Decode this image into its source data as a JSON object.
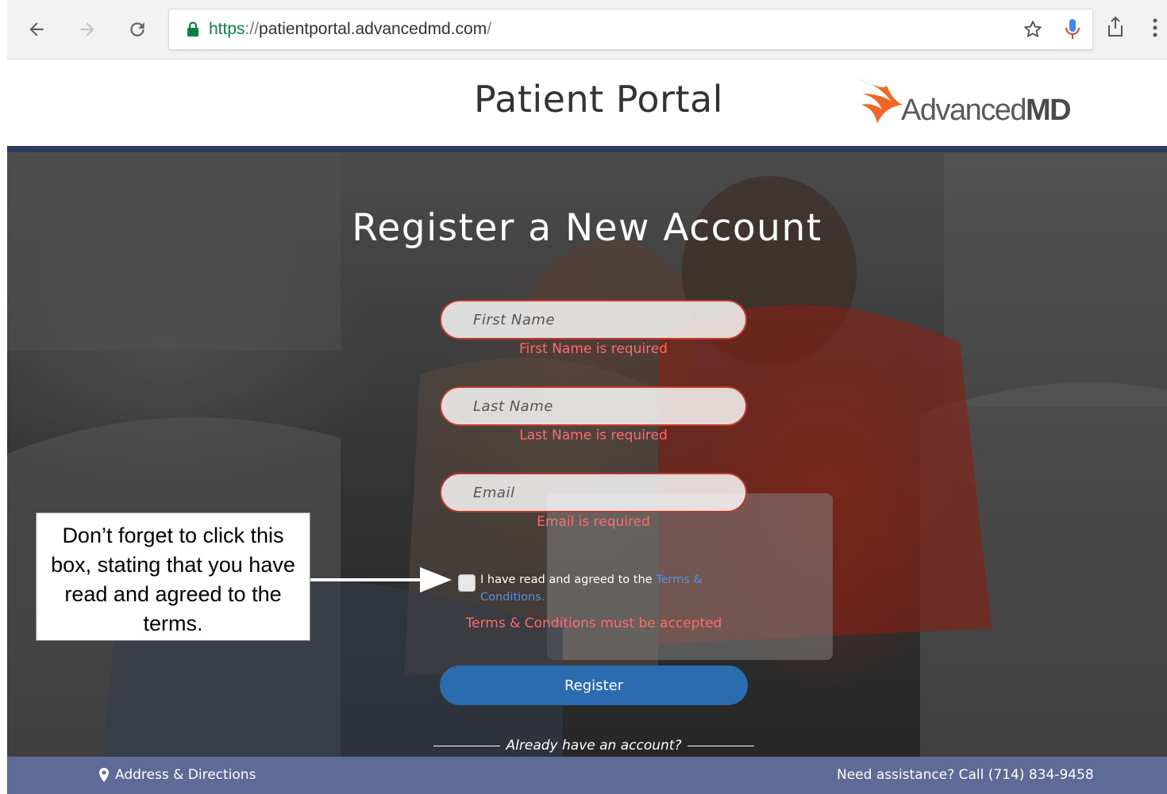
{
  "browser": {
    "url_scheme": "https",
    "url_sep": "://",
    "url_host": "patientportal.advancedmd.com",
    "url_path": "/",
    "icons": [
      "back-icon",
      "forward-icon",
      "reload-icon",
      "lock-icon",
      "star-icon",
      "mic-icon",
      "share-icon",
      "menu-icon"
    ]
  },
  "header": {
    "title": "Patient Portal",
    "logo_text_light": "Advanced",
    "logo_text_bold": "MD",
    "accent_color": "#2e3c5c",
    "logo_color": "#f26522"
  },
  "form": {
    "title": "Register a New Account",
    "first_name": {
      "placeholder": "First Name",
      "value": "",
      "error": "First Name is required"
    },
    "last_name": {
      "placeholder": "Last Name",
      "value": "",
      "error": "Last Name is required"
    },
    "email": {
      "placeholder": "Email",
      "value": "",
      "error": "Email is required"
    },
    "terms": {
      "checked": false,
      "text": "I have read and agreed to the",
      "link": "Terms & Conditions.",
      "error": "Terms & Conditions must be accepted"
    },
    "register_label": "Register",
    "already_label": "Already have an account?",
    "error_color": "#ff6b6b",
    "button_color": "#2b6cb0"
  },
  "callout": {
    "text": "Don’t forget to click this box, stating that you have read and agreed to the terms."
  },
  "footer": {
    "address_label": "Address & Directions",
    "assistance": "Need assistance? Call (714) 834-9458",
    "bg_color": "#5e6b96"
  }
}
